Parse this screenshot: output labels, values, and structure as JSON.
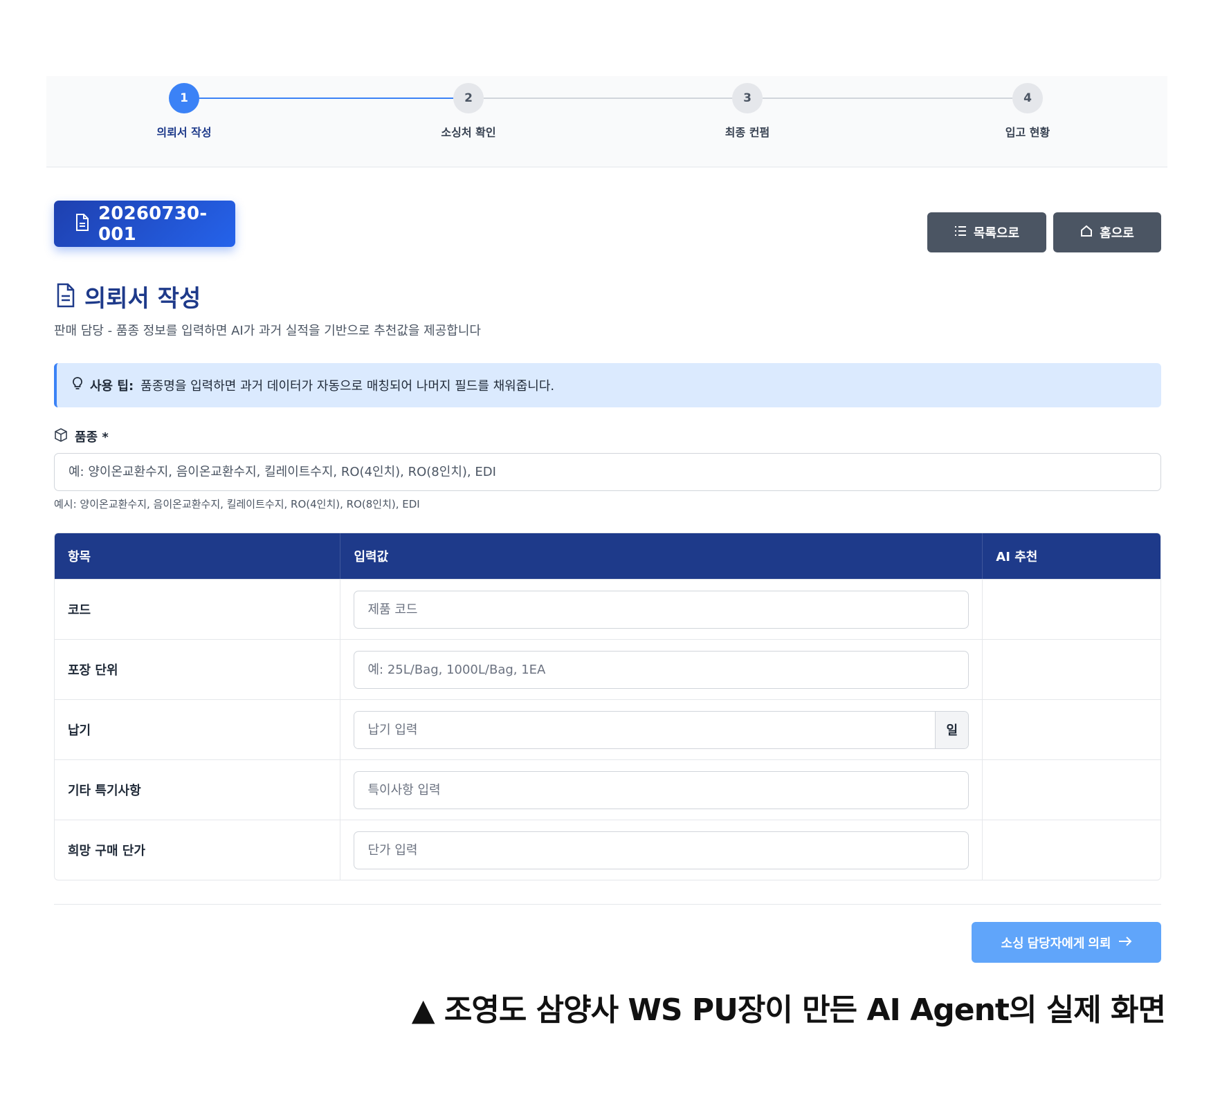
{
  "stepper": {
    "steps": [
      {
        "num": "1",
        "label": "의뢰서 작성"
      },
      {
        "num": "2",
        "label": "소싱처 확인"
      },
      {
        "num": "3",
        "label": "최종 컨펌"
      },
      {
        "num": "4",
        "label": "입고 현황"
      }
    ],
    "active": 1
  },
  "doc_number": "20260730-001",
  "buttons": {
    "list_label": "목록으로",
    "home_label": "홈으로",
    "submit_label": "소싱 담당자에게 의뢰"
  },
  "page": {
    "title": "의뢰서 작성",
    "subtitle": "판매 담당 - 품종 정보를 입력하면 AI가 과거 실적을 기반으로 추천값을 제공합니다"
  },
  "tip": {
    "label": "사용 팁:",
    "text": "품종명을 입력하면 과거 데이터가 자동으로 매칭되어 나머지 필드를 채워줍니다."
  },
  "variety": {
    "label": "품종 *",
    "placeholder": "예: 양이온교환수지, 음이온교환수지, 킬레이트수지, RO(4인치), RO(8인치), EDI",
    "example": "예시: 양이온교환수지, 음이온교환수지, 킬레이트수지, RO(4인치), RO(8인치), EDI"
  },
  "table": {
    "headers": [
      "항목",
      "입력값",
      "AI 추천"
    ],
    "rows": [
      {
        "label": "코드",
        "placeholder": "제품 코드",
        "ai": ""
      },
      {
        "label": "포장 단위",
        "placeholder": "예: 25L/Bag, 1000L/Bag, 1EA",
        "ai": ""
      },
      {
        "label": "납기",
        "placeholder": "납기 입력",
        "suffix": "일",
        "ai": ""
      },
      {
        "label": "기타 특기사항",
        "placeholder": "특이사항 입력",
        "ai": ""
      },
      {
        "label": "희망 구매 단가",
        "placeholder": "단가 입력",
        "ai": ""
      }
    ]
  },
  "caption": "▲ 조영도 삼양사 WS PU장이 만든 AI Agent의 실제 화면",
  "colors": {
    "primary": "#1e3a8a",
    "accent": "#3b82f6",
    "button_gray": "#4b5563",
    "tip_bg": "#dbeafe",
    "submit": "#60a5fa"
  }
}
